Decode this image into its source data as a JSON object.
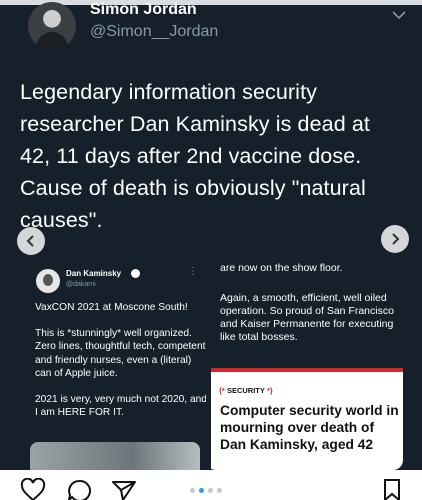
{
  "tweet": {
    "author_name": "Simon Jordan",
    "author_handle": "@Simon__Jordan",
    "text": "Legendary information security researcher Dan Kaminsky is dead at 42, 11 days after 2nd vaccine dose. Cause of death is obviously \"natural causes\"."
  },
  "embedded_left": {
    "name": "Dan Kaminsky",
    "handle": "@dakami",
    "more": "⋮",
    "paragraphs": [
      "VaxCON 2021 at Moscone South!",
      "This is *stunningly* well organized. Zero lines, thoughtful tech, competent and friendly nurses, even a (literal) can of Apple juice.",
      "2021 is very, very much not 2020, and I am HERE FOR IT."
    ]
  },
  "embedded_right": {
    "top_text": "are now on the show floor.",
    "body_text": "Again, a smooth, efficient, well oiled operation.  So proud of San Francisco and Kaiser Permanente for executing like total bosses.",
    "article_tag_open": "{*",
    "article_tag": "SECURITY",
    "article_tag_close": "*}",
    "article_headline": "Computer security world in mourning over death of Dan Kaminsky, aged 42"
  },
  "carousel": {
    "total": 4,
    "active_index": 1
  },
  "icons": {
    "left_arrow": "chevron-left-icon",
    "right_arrow": "chevron-right-icon",
    "like": "heart-icon",
    "comment": "comment-icon",
    "share": "send-icon",
    "save": "bookmark-icon",
    "menu": "chevron-down-icon"
  },
  "colors": {
    "background": "#15202b",
    "accent": "#3897f0",
    "article_red": "#d7262b"
  }
}
